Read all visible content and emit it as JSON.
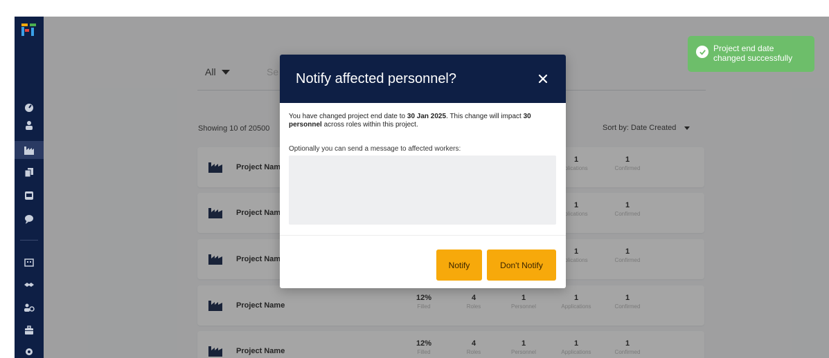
{
  "sidebar": {
    "logo": "app-logo",
    "icons": [
      "dashboard-icon",
      "user-icon",
      "projects-icon",
      "documents-icon",
      "inbox-icon",
      "chat-icon",
      "building-icon",
      "handshake-icon",
      "team-icon",
      "briefcase-icon",
      "settings-icon"
    ],
    "active_icon": "projects-icon",
    "colors": {
      "background": "#0e1f45",
      "active": "#2a3a63"
    }
  },
  "filters": {
    "all_label": "All",
    "search_fragment": "Se"
  },
  "list": {
    "showing": "Showing 10 of 20500",
    "sort_label": "Sort by: Date Created",
    "cards": [
      {
        "name": "Project Nam",
        "filled": "",
        "filled_label": "",
        "roles": "",
        "roles_label": "",
        "personnel": "",
        "personnel_label": "",
        "applications": "1",
        "applications_label": "plications",
        "confirmed": "1",
        "confirmed_label": "Confirmed"
      },
      {
        "name": "Project Nam",
        "filled": "",
        "filled_label": "",
        "roles": "",
        "roles_label": "",
        "personnel": "",
        "personnel_label": "",
        "applications": "1",
        "applications_label": "plications",
        "confirmed": "1",
        "confirmed_label": "Confirmed"
      },
      {
        "name": "Project Nam",
        "filled": "",
        "filled_label": "",
        "roles": "",
        "roles_label": "",
        "personnel": "",
        "personnel_label": "",
        "applications": "1",
        "applications_label": "plications",
        "confirmed": "1",
        "confirmed_label": "Confirmed"
      },
      {
        "name": "Project Name",
        "filled": "12%",
        "filled_label": "Filled",
        "roles": "4",
        "roles_label": "Roles",
        "personnel": "1",
        "personnel_label": "Personnel",
        "applications": "1",
        "applications_label": "Applications",
        "confirmed": "1",
        "confirmed_label": "Confirmed"
      },
      {
        "name": "Project Name",
        "filled": "12%",
        "filled_label": "Filled",
        "roles": "4",
        "roles_label": "Roles",
        "personnel": "1",
        "personnel_label": "Personnel",
        "applications": "1",
        "applications_label": "Applications",
        "confirmed": "1",
        "confirmed_label": "Confirmed"
      }
    ]
  },
  "toast": {
    "line1": "Project end date",
    "line2": "changed successfully",
    "color": "#6dbe6a"
  },
  "modal": {
    "title": "Notify affected personnel?",
    "body_prefix": "You have changed project end date to ",
    "body_date": "30 Jan 2025",
    "body_mid": ". This change will impact ",
    "body_count": "30 personnel",
    "body_suffix": " across roles within this project.",
    "optional_label": "Optionally you can send a message to affected workers:",
    "message_value": "",
    "notify_label": "Notify",
    "dont_notify_label": "Don't Notify",
    "header_color": "#0e1f45",
    "button_color": "#f7a90b"
  }
}
